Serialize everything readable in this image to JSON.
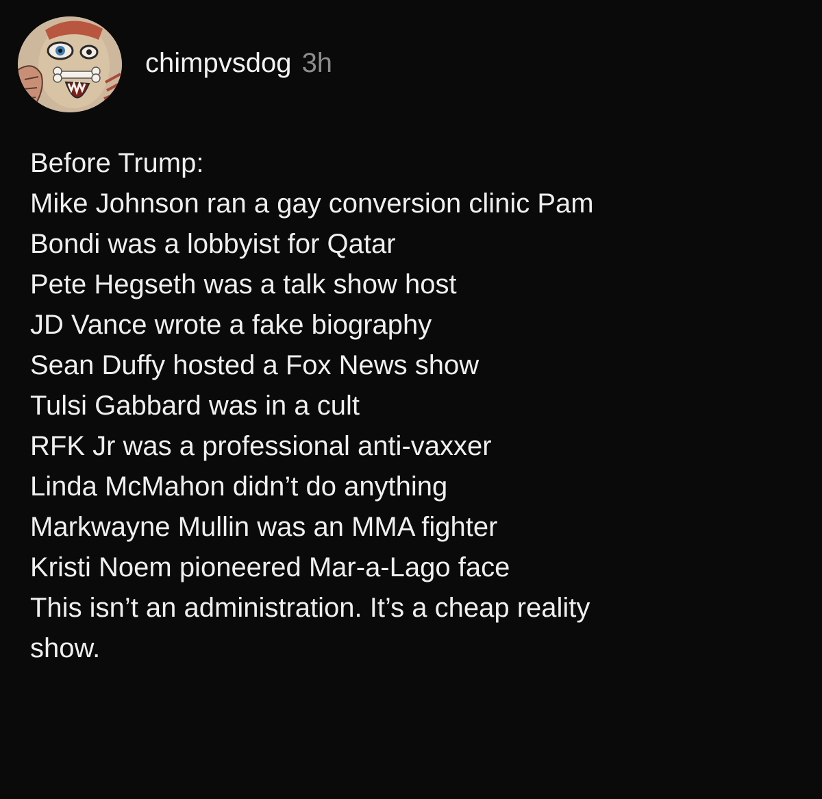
{
  "post": {
    "author": {
      "username": "chimpvsdog",
      "timestamp": "3h",
      "avatar_icon": "illustrated-face-avatar"
    },
    "lines": [
      "Before Trump:",
      "Mike Johnson ran a gay conversion clinic Pam",
      "Bondi was a lobbyist for Qatar",
      "Pete Hegseth was a talk show host",
      "JD Vance wrote a fake biography",
      "Sean Duffy hosted a Fox News show",
      "Tulsi Gabbard was in a cult",
      "RFK Jr was a professional anti-vaxxer",
      "Linda McMahon didn’t do anything",
      "Markwayne Mullin was an MMA fighter",
      "Kristi Noem pioneered Mar-a-Lago face",
      "This isn’t an administration. It’s a cheap reality",
      "show."
    ]
  },
  "colors": {
    "background": "#0b0a0b",
    "text": "#efefef",
    "timestamp": "#8c8c8c"
  }
}
